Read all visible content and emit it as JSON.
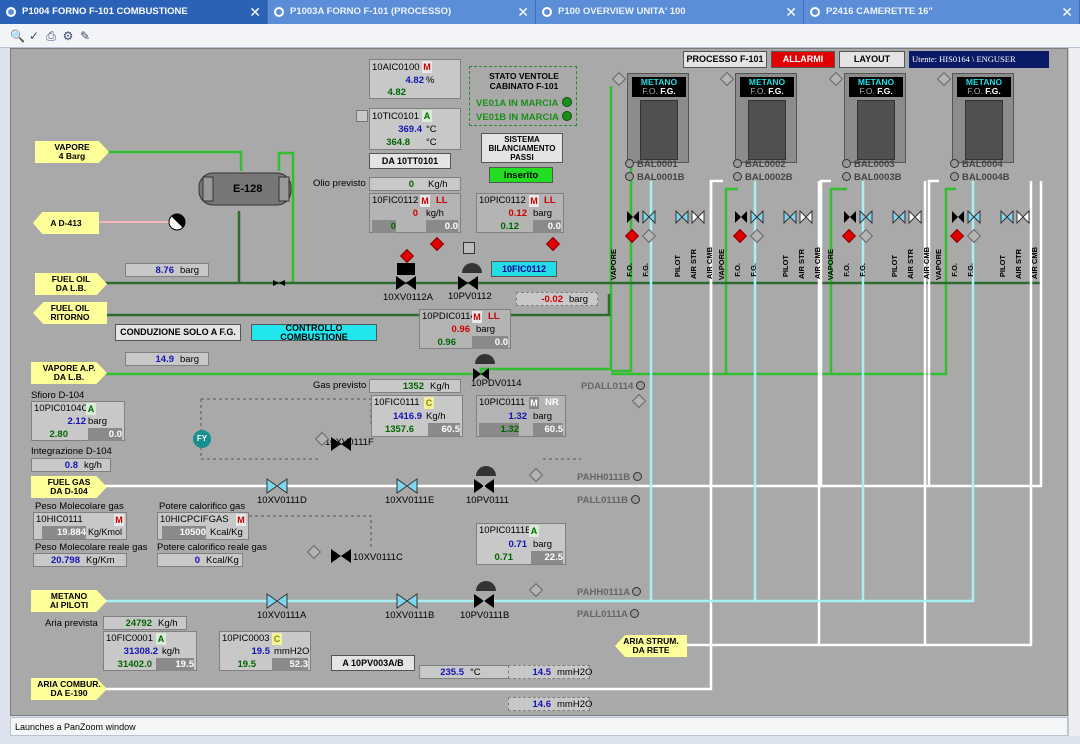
{
  "tabs": [
    {
      "label": "P1004 FORNO F-101 COMBUSTIONE",
      "active": true
    },
    {
      "label": "P1003A FORNO F-101 (PROCESSO)",
      "active": false
    },
    {
      "label": "P100 OVERVIEW UNITA' 100",
      "active": false
    },
    {
      "label": "P2416 CAMERETTE 16\"",
      "active": false
    }
  ],
  "toolbar_icons": [
    "zoom-icon",
    "check-icon",
    "print-icon",
    "network-icon",
    "pen-icon"
  ],
  "status_bar": "Launches a PanZoom window",
  "header_buttons": {
    "processo": "PROCESSO F-101",
    "allarmi": "ALLARMI",
    "layout": "LAYOUT",
    "utente": "Utente:  HIS0164 \\ ENGUSER"
  },
  "colors": {
    "alarm_red": "#e00000",
    "cyan_button": "#22dde6",
    "process_green": "#2fbf2f",
    "pipe_white": "#ffffff",
    "pipe_cyan": "#a6f0f6"
  },
  "flags": {
    "vapore4": "VAPORE\n4 Barg",
    "ad413": "A D-413",
    "fueloil_lb": "FUEL OIL\nDA L.B.",
    "fueloil_rit": "FUEL OIL\nRITORNO",
    "vapore_ap": "VAPORE A.P.\nDA L.B.",
    "fuelgas": "FUEL GAS\nDA D-104",
    "metano": "METANO\nAI PILOTI",
    "aria_comb": "ARIA COMBUR.\nDA E-190",
    "aria_strum": "ARIA STRUM.\nDA RETE"
  },
  "exchanger": "E-128",
  "aic0100": {
    "tag": "10AIC0100",
    "mode": "M",
    "pv": "4.82",
    "unit": "%",
    "op": "4.82"
  },
  "tic0101": {
    "tag": "10TIC0101",
    "mode": "A",
    "pv": "369.4",
    "unit": "°C",
    "sp": "364.8",
    "sp_unit": "°C"
  },
  "stato_ventole": {
    "title": "STATO VENTOLE\nCABINATO F-101",
    "ve01a": "VE01A IN MARCIA",
    "ve01b": "VE01B IN MARCIA"
  },
  "btn_da_tt": "DA 10TT0101",
  "sistema_bilanciamento": "SISTEMA\nBILANCIAMENTO\nPASSI",
  "inserito": "Inserito",
  "olio_previsto": {
    "label": "Olio previsto",
    "value": "0",
    "unit": "Kg/h"
  },
  "fic0112": {
    "tag": "10FIC0112",
    "mode": "M",
    "alarm": "LL",
    "pv": "0",
    "unit": "kg/h",
    "sp": "0",
    "out": "0.0"
  },
  "pic0112": {
    "tag": "10PIC0112",
    "mode": "M",
    "alarm": "LL",
    "pv": "0.12",
    "unit": "barg",
    "sp": "0.12",
    "out": "0.0"
  },
  "btn_fic0112": "10FIC0112",
  "fueloil_press": {
    "value": "8.76",
    "unit": "barg"
  },
  "xv0112a": "10XV0112A",
  "pv0112": "10PV0112",
  "ret_press": {
    "value": "-0.02",
    "unit": "barg"
  },
  "btn_conduzione": "CONDUZIONE SOLO A F.G.",
  "btn_controllo": "CONTROLLO COMBUSTIONE",
  "pdic0114": {
    "tag": "10PDIC0114",
    "mode": "M",
    "alarm": "LL",
    "pv": "0.96",
    "unit": "barg",
    "sp": "0.96",
    "out": "0.0"
  },
  "vapore_ap_press": {
    "value": "14.9",
    "unit": "barg"
  },
  "pdv0114": "10PDV0114",
  "gas_previsto": {
    "label": "Gas previsto",
    "value": "1352",
    "unit": "Kg/h"
  },
  "pdall0114": "PDALL0114",
  "sfioro": {
    "label": "Sfioro D-104",
    "tag": "10PIC0104C",
    "mode": "A",
    "pv": "2.12",
    "unit": "barg",
    "sp": "2.80",
    "out": "0.0"
  },
  "fic0111": {
    "tag": "10FIC0111",
    "mode": "C",
    "pv": "1416.9",
    "unit": "Kg/h",
    "sp": "1357.6",
    "out": "60.5"
  },
  "pic0111": {
    "tag": "10PIC0111",
    "mode": "M",
    "alarm": "NR",
    "pv": "1.32",
    "unit": "barg",
    "sp": "1.32",
    "out": "60.5"
  },
  "fy": "FY",
  "xv0111f": "10XV0111F",
  "integrazione": {
    "label": "Integrazione D-104",
    "value": "0.8",
    "unit": "kg/h"
  },
  "xv0111d": "10XV0111D",
  "xv0111e": "10XV0111E",
  "pv0111": "10PV0111",
  "pahh0111b": "PAHH0111B",
  "pall0111b": "PALL0111B",
  "peso_mol": {
    "label": "Peso Molecolare gas",
    "tag": "10HIC0111",
    "mode": "M",
    "value": "19.884",
    "unit": "Kg/Kmol",
    "real_label": "Peso Molecolare reale gas",
    "real_value": "20.798",
    "real_unit": "Kg/Km"
  },
  "potere": {
    "label": "Potere calorifico gas",
    "tag": "10HICPCIFGAS",
    "mode": "M",
    "value": "10500",
    "unit": "Kcal/Kg",
    "real_label": "Potere calorifico reale gas",
    "real_value": "0",
    "real_unit": "Kcal/Kg"
  },
  "xv0111c": "10XV0111C",
  "pic0111b": {
    "tag": "10PIC0111B",
    "mode": "A",
    "pv": "0.71",
    "unit": "barg",
    "sp": "0.71",
    "out": "22.5"
  },
  "pahh0111a": "PAHH0111A",
  "pall0111a": "PALL0111A",
  "xv0111a": "10XV0111A",
  "xv0111b": "10XV0111B",
  "pv0111b": "10PV0111B",
  "aria_prevista": {
    "label": "Aria prevista",
    "value": "24792",
    "unit": "Kg/h"
  },
  "fic0001": {
    "tag": "10FIC0001",
    "mode": "A",
    "pv": "31308.2",
    "unit": "kg/h",
    "sp": "31402.0",
    "out": "19.5"
  },
  "pic0003": {
    "tag": "10PIC0003",
    "mode": "C",
    "pv": "19.5",
    "unit": "mmH2O",
    "sp": "19.5",
    "out": "52.3"
  },
  "btn_pv003": "A 10PV003A/B",
  "temp_aria": {
    "value": "235.5",
    "unit": "°C"
  },
  "press_aria1": {
    "value": "14.5",
    "unit": "mmH2O"
  },
  "press_aria2": {
    "value": "14.6",
    "unit": "mmH2O"
  },
  "burners": [
    {
      "fuel": "METANO",
      "fo": "F.O.",
      "fg": "F.G.",
      "bal1": "BAL0001",
      "bal2": "BAL0001B"
    },
    {
      "fuel": "METANO",
      "fo": "F.O.",
      "fg": "F.G.",
      "bal1": "BAL0002",
      "bal2": "BAL0002B"
    },
    {
      "fuel": "METANO",
      "fo": "F.O.",
      "fg": "F.G.",
      "bal1": "BAL0003",
      "bal2": "BAL0003B"
    },
    {
      "fuel": "METANO",
      "fo": "F.O.",
      "fg": "F.G.",
      "bal1": "BAL0004",
      "bal2": "BAL0004B"
    }
  ],
  "burner_line_labels": [
    "VAPORE",
    "F.O.",
    "F.G.",
    "PILOT",
    "AIR STR",
    "AIR CMB"
  ],
  "fc_label": "F.C.",
  "fo_label": "F.O."
}
